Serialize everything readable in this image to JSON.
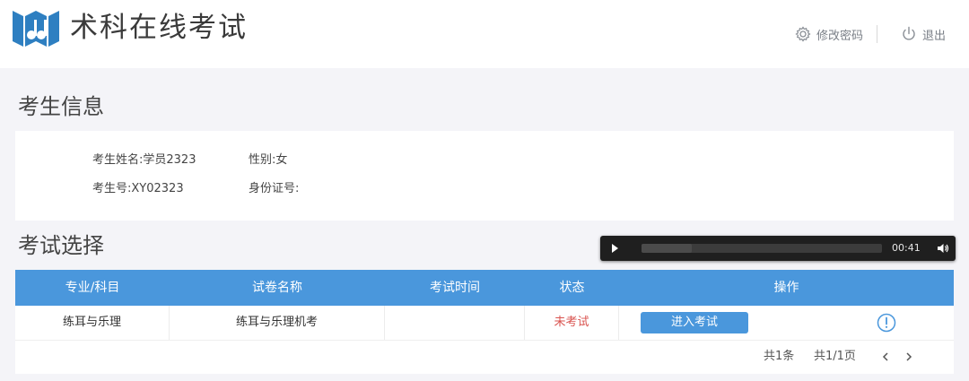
{
  "header": {
    "app_title": "术科在线考试",
    "change_password": "修改密码",
    "logout": "退出",
    "accent_color": "#2e7fc1"
  },
  "candidate": {
    "section_title": "考生信息",
    "name_label": "考生姓名:",
    "name_value": "学员2323",
    "gender_label": "性别:",
    "gender_value": "女",
    "id_label": "考生号:",
    "id_value": "XY02323",
    "idcard_label": "身份证号:",
    "idcard_value": ""
  },
  "exam": {
    "section_title": "考试选择",
    "columns": [
      "专业/科目",
      "试卷名称",
      "考试时间",
      "状态",
      "操作"
    ],
    "rows": [
      {
        "subject": "练耳与乐理",
        "paper": "练耳与乐理机考",
        "time": "",
        "status": "未考试",
        "action": "进入考试"
      }
    ],
    "header_color": "#4a97dc",
    "status_color": "#d9534f"
  },
  "audio_player": {
    "time": "00:41",
    "progress": 0.21
  },
  "pagination": {
    "total": "共1条",
    "pages": "共1/1页"
  }
}
